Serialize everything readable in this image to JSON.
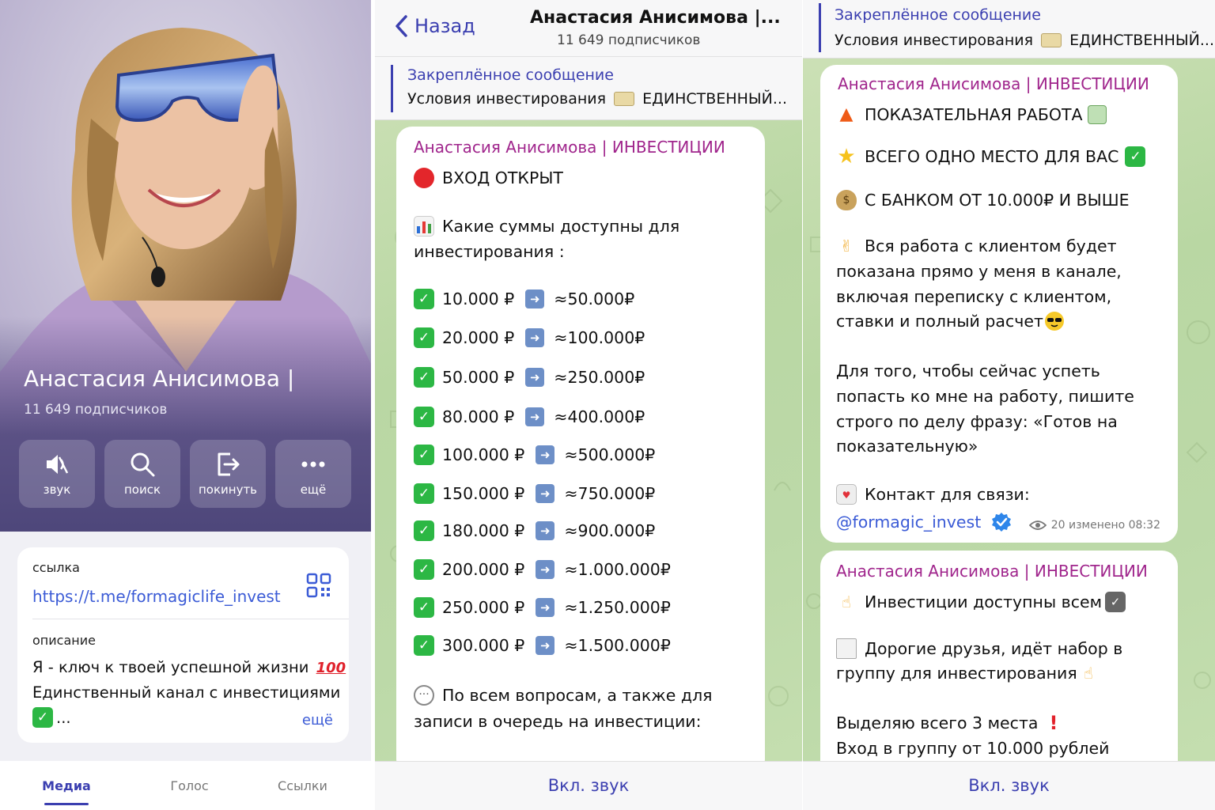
{
  "profile": {
    "name": "Анастасия Анисимова |",
    "subscribers": "11 649 подписчиков",
    "actions": [
      {
        "label": "звук",
        "icon": "speaker-muted-icon"
      },
      {
        "label": "поиск",
        "icon": "search-icon"
      },
      {
        "label": "покинуть",
        "icon": "leave-icon"
      },
      {
        "label": "ещё",
        "icon": "more-dots-icon"
      }
    ],
    "link_label": "ссылка",
    "link": "https://t.me/formagiclife_invest",
    "description_label": "описание",
    "description_lines": [
      "Я - ключ к твоей успешной жизни",
      "Единственный канал с инвестициями",
      "..."
    ],
    "more": "ещё",
    "tabs": [
      "Медиа",
      "Голос",
      "Ссылки"
    ]
  },
  "chat": {
    "back": "Назад",
    "title": "Анастасия Анисимова |...",
    "subscribers": "11 649 подписчиков",
    "pinned_title": "Закреплённое сообщение",
    "pinned_text": "Условия инвестирования",
    "pinned_text2": "ЕДИНСТВЕННЫЙ...",
    "unmute": "Вкл. звук",
    "author": "Анастасия Анисимова | ИНВЕСТИЦИИ",
    "msg1": {
      "open": "ВХОД ОТКРЫТ",
      "q1": "Какие суммы доступны для",
      "q2": "инвестирования :",
      "rows": [
        {
          "from": "10.000 ₽",
          "to": "≈50.000₽"
        },
        {
          "from": "20.000 ₽",
          "to": "≈100.000₽"
        },
        {
          "from": "50.000 ₽",
          "to": "≈250.000₽"
        },
        {
          "from": "80.000 ₽",
          "to": "≈400.000₽"
        },
        {
          "from": "100.000 ₽",
          "to": "≈500.000₽"
        },
        {
          "from": "150.000 ₽",
          "to": "≈750.000₽"
        },
        {
          "from": "180.000 ₽",
          "to": "≈900.000₽"
        },
        {
          "from": "200.000 ₽",
          "to": "≈1.000.000₽"
        },
        {
          "from": "250.000 ₽",
          "to": "≈1.250.000₽"
        },
        {
          "from": "300.000 ₽",
          "to": "≈1.500.000₽"
        }
      ],
      "tail1": "По всем вопросам, а также для",
      "tail2": "записи в очередь на инвестиции:"
    },
    "msg2": {
      "l1": "ПОКАЗАТЕЛЬНАЯ РАБОТА",
      "l2": "ВСЕГО ОДНО МЕСТО ДЛЯ ВАС",
      "l3": "С БАНКОМ ОТ 10.000₽ И ВЫШЕ",
      "p1": [
        "Вся работа с клиентом будет",
        "показана прямо у меня в канале,",
        "включая переписку с клиентом,",
        "ставки и полный расчет"
      ],
      "p2": [
        "Для того, чтобы сейчас успеть",
        "попасть ко мне на работу, пишите",
        "строго по делу фразу: «Готов на",
        "показательную»"
      ],
      "contact": "Контакт для связи:",
      "handle": "@formagic_invest",
      "meta": "20 изменено 08:32"
    },
    "msg3": {
      "l1": "Инвестиции доступны всем",
      "l2": "Дорогие друзья, идёт набор в",
      "l3": "группу для инвестирования",
      "l4": "Выделяю всего 3 места",
      "l5": "Вход в группу от 10.000 рублей"
    }
  },
  "colors": {
    "accent": "#3b3fb0",
    "author": "#a0258c",
    "link": "#3b5bd6",
    "chat_bg": "#c3dcad"
  }
}
